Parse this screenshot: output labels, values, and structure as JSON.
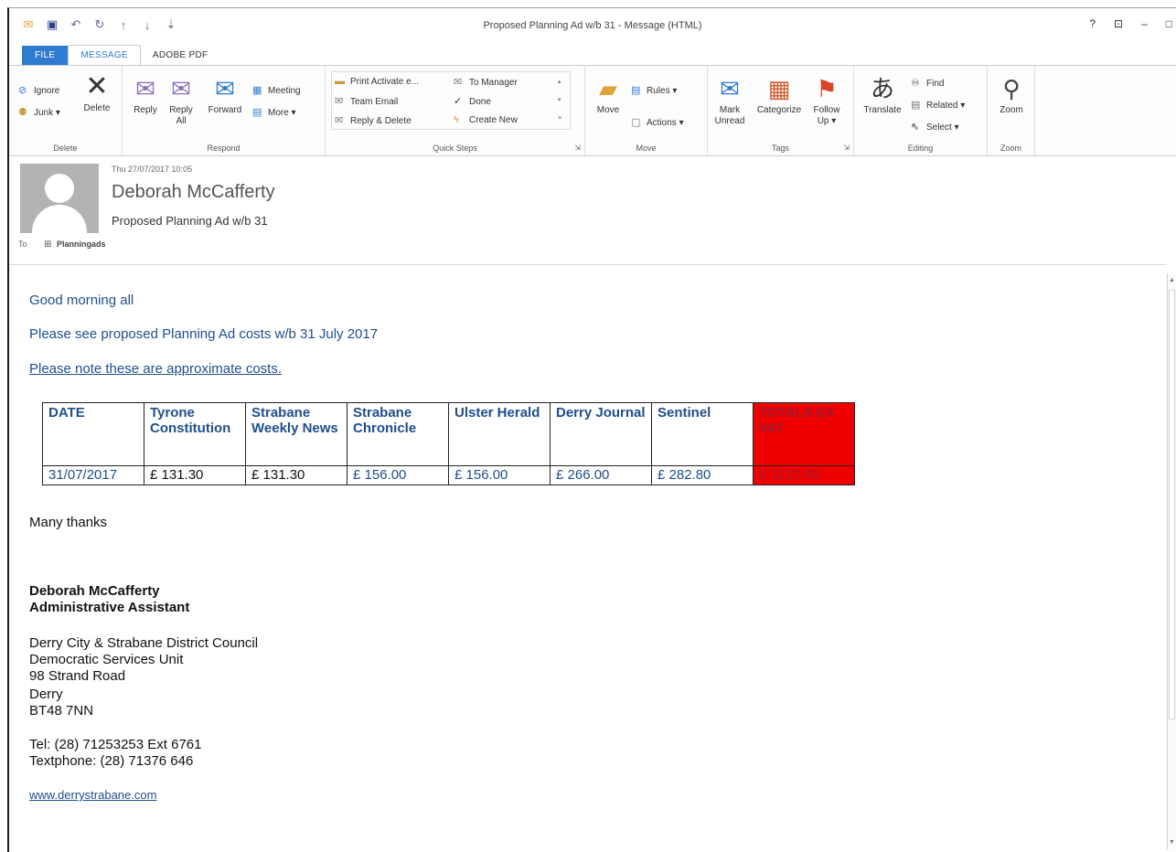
{
  "window": {
    "title": "Proposed Planning Ad w/b 31  - Message (HTML)",
    "controls": [
      "?",
      "⊡",
      "–",
      "□"
    ]
  },
  "tabs": [
    "FILE",
    "MESSAGE",
    "ADOBE PDF"
  ],
  "ribbon": {
    "delete_group": {
      "label": "Delete",
      "ignore": "Ignore",
      "junk": "Junk ▾",
      "delete": "Delete"
    },
    "respond_group": {
      "label": "Respond",
      "reply": "Reply",
      "reply_all": "Reply All",
      "forward": "Forward",
      "meeting": "Meeting",
      "more": "More ▾"
    },
    "quick_steps": {
      "label": "Quick Steps",
      "items": [
        "Print Activate e...",
        "Team Email",
        "Reply & Delete",
        "To Manager",
        "Done",
        "Create New"
      ]
    },
    "move_group": {
      "label": "Move",
      "move": "Move",
      "rules": "Rules ▾",
      "actions": "Actions ▾"
    },
    "tags_group": {
      "label": "Tags",
      "mark_unread": "Mark Unread",
      "categorize": "Categorize",
      "follow_up": "Follow Up ▾"
    },
    "editing_group": {
      "label": "Editing",
      "translate": "Translate",
      "find": "Find",
      "related": "Related ▾",
      "select": "Select ▾"
    },
    "zoom_group": {
      "label": "Zoom",
      "zoom": "Zoom"
    }
  },
  "header": {
    "date": "Thu 27/07/2017 10:05",
    "sender": "Deborah McCafferty",
    "subject": "Proposed Planning Ad w/b 31",
    "to_label": "To",
    "recipient": "Planningads"
  },
  "message": {
    "greeting": "Good morning all",
    "intro": "Please see proposed Planning Ad costs w/b 31 July  2017",
    "note": "Please note these are approximate costs.",
    "table": {
      "headers": [
        "DATE",
        "Tyrone Constitution",
        "Strabane Weekly News",
        "Strabane Chronicle",
        "Ulster Herald",
        "Derry Journal",
        "Sentinel",
        "TOTALS EX VAT"
      ],
      "row": [
        "31/07/2017",
        "£ 131.30",
        "£ 131.30",
        "£ 156.00",
        "£ 156.00",
        "£ 266.00",
        "£ 282.80",
        "£ 1123.40"
      ],
      "highlight_color": "#ee0000"
    },
    "thanks": "Many thanks",
    "signature": {
      "name": "Deborah McCafferty",
      "role": "Administrative Assistant",
      "address": [
        "Derry City & Strabane District Council",
        "Democratic Services Unit",
        "98 Strand Road",
        "Derry",
        "BT48 7NN"
      ],
      "tel": "Tel: (28) 71253253 Ext 6761",
      "textphone": "Textphone: (28) 71376 646",
      "website": "www.derrystrabane.com"
    }
  }
}
